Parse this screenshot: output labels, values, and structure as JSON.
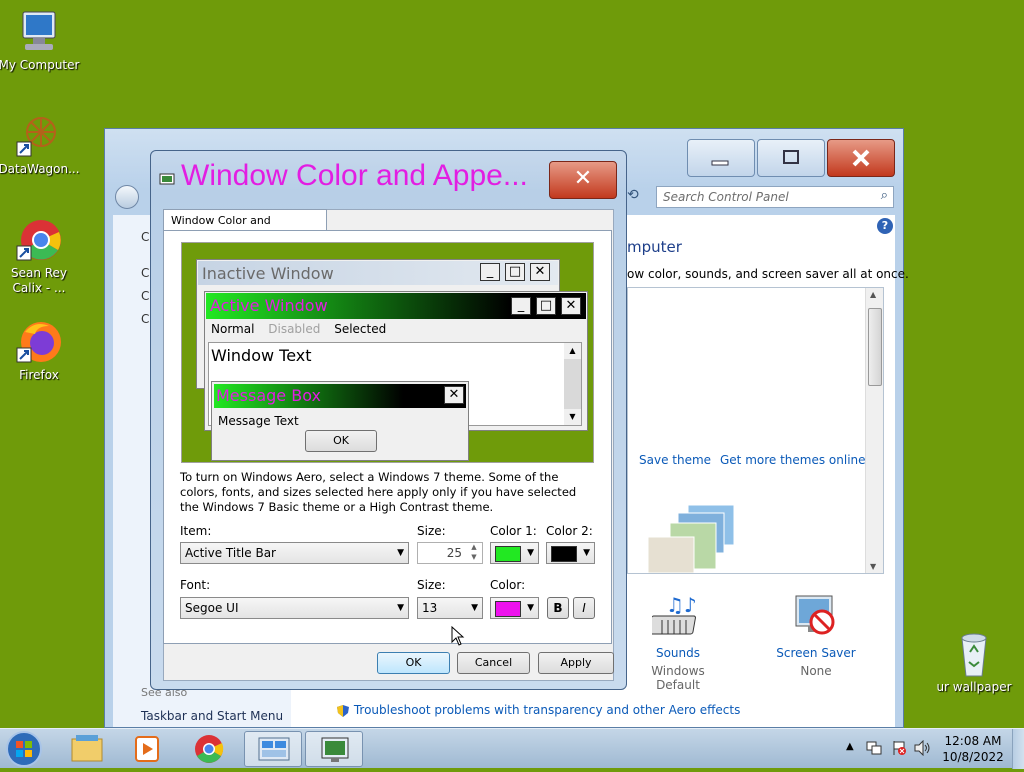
{
  "desktop": {
    "icons": [
      {
        "label": "My Computer"
      },
      {
        "label": "DataWagon..."
      },
      {
        "label": "Sean Rey Calix - ..."
      },
      {
        "label": "Firefox"
      },
      {
        "label": "ur wallpaper"
      }
    ]
  },
  "control_panel": {
    "search_placeholder": "Search Control Panel",
    "heading": "mputer",
    "subheading": "ow color, sounds, and screen saver all at once.",
    "save_theme": "Save theme",
    "get_more_themes": "Get more themes online",
    "sounds_label": "Sounds",
    "sounds_value": "Windows Default",
    "screen_saver_label": "Screen Saver",
    "screen_saver_value": "None",
    "see_also": "See also",
    "taskbar_link": "Taskbar and Start Menu",
    "troubleshoot_link": "Troubleshoot problems with transparency and other Aero effects",
    "side_letters": [
      "C",
      "C",
      "C",
      "C"
    ]
  },
  "dialog": {
    "title": "Window Color and Appe...",
    "tab_label": "Window Color and Appearance",
    "preview": {
      "inactive_title": "Inactive Window",
      "active_title": "Active Window",
      "menu_normal": "Normal",
      "menu_disabled": "Disabled",
      "menu_selected": "Selected",
      "window_text": "Window Text",
      "message_box_title": "Message Box",
      "message_text": "Message Text",
      "ok": "OK"
    },
    "info_text": "To turn on Windows Aero, select a Windows 7 theme.  Some of the colors, fonts, and sizes selected here apply only if you have selected the Windows 7 Basic theme or a High Contrast theme.",
    "item_label": "Item:",
    "item_value": "Active Title Bar",
    "size_label": "Size:",
    "item_size": "25",
    "color1_label": "Color 1:",
    "color1": "#22e822",
    "color2_label": "Color 2:",
    "color2": "#000000",
    "font_label": "Font:",
    "font_value": "Segoe UI",
    "font_size_label": "Size:",
    "font_size": "13",
    "font_color_label": "Color:",
    "font_color": "#ee11ee",
    "bold": "B",
    "italic": "I",
    "ok": "OK",
    "cancel": "Cancel",
    "apply": "Apply"
  },
  "taskbar": {
    "time": "12:08 AM",
    "date": "10/8/2022"
  }
}
